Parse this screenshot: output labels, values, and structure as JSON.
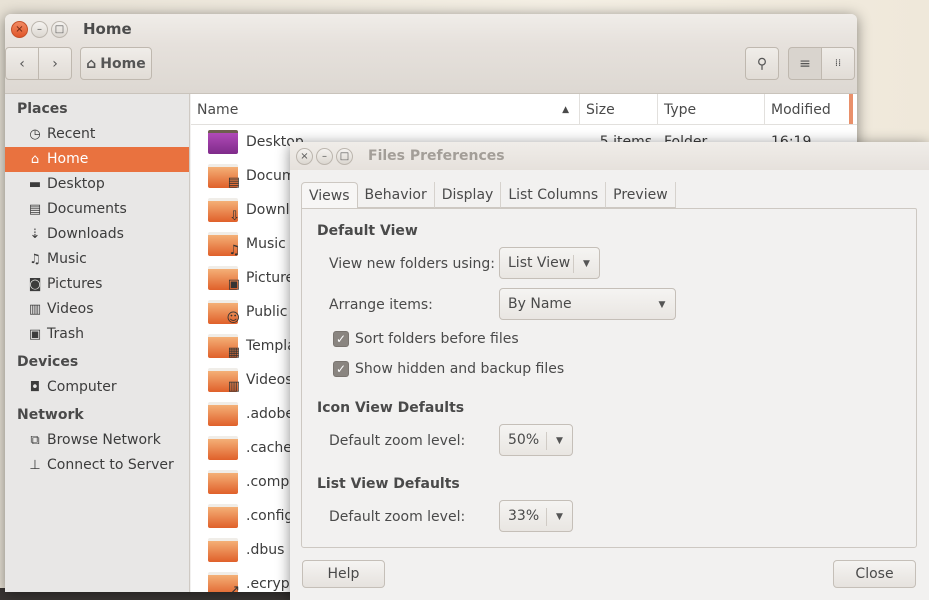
{
  "window": {
    "title": "Home",
    "path": "Home"
  },
  "sidebar": {
    "places_label": "Places",
    "places": [
      {
        "label": "Recent",
        "icon": "clock-icon"
      },
      {
        "label": "Home",
        "icon": "home-icon",
        "selected": true
      },
      {
        "label": "Desktop",
        "icon": "desktop-icon"
      },
      {
        "label": "Documents",
        "icon": "documents-icon"
      },
      {
        "label": "Downloads",
        "icon": "download-icon"
      },
      {
        "label": "Music",
        "icon": "music-icon"
      },
      {
        "label": "Pictures",
        "icon": "camera-icon"
      },
      {
        "label": "Videos",
        "icon": "film-icon"
      },
      {
        "label": "Trash",
        "icon": "trash-icon"
      }
    ],
    "devices_label": "Devices",
    "devices": [
      {
        "label": "Computer",
        "icon": "drive-icon"
      }
    ],
    "network_label": "Network",
    "network": [
      {
        "label": "Browse Network",
        "icon": "network-icon"
      },
      {
        "label": "Connect to Server",
        "icon": "server-icon"
      }
    ]
  },
  "list": {
    "columns": [
      "Name",
      "Size",
      "Type",
      "Modified"
    ],
    "first_row": {
      "name": "Desktop",
      "size": "5 items",
      "type": "Folder",
      "modified": "16:19"
    },
    "rows": [
      "Docum",
      "Downl",
      "Music",
      "Picture",
      "Public",
      "Templa",
      "Videos",
      ".adobe",
      ".cache",
      ".comp",
      ".config",
      ".dbus",
      ".ecrypt"
    ]
  },
  "prefs": {
    "title": "Files Preferences",
    "tabs": [
      "Views",
      "Behavior",
      "Display",
      "List Columns",
      "Preview"
    ],
    "default_view": "Default View",
    "view_new_label": "View new folders using:",
    "view_new_value": "List View",
    "arrange_label": "Arrange items:",
    "arrange_value": "By Name",
    "sort_folders": "Sort folders before files",
    "show_hidden": "Show hidden and backup files",
    "icon_defaults": "Icon View Defaults",
    "icon_zoom_label": "Default zoom level:",
    "icon_zoom_value": "50%",
    "list_defaults": "List View Defaults",
    "list_zoom_label": "Default zoom level:",
    "list_zoom_value": "33%",
    "help": "Help",
    "close": "Close"
  },
  "colors": {
    "accent": "#e9723f"
  }
}
